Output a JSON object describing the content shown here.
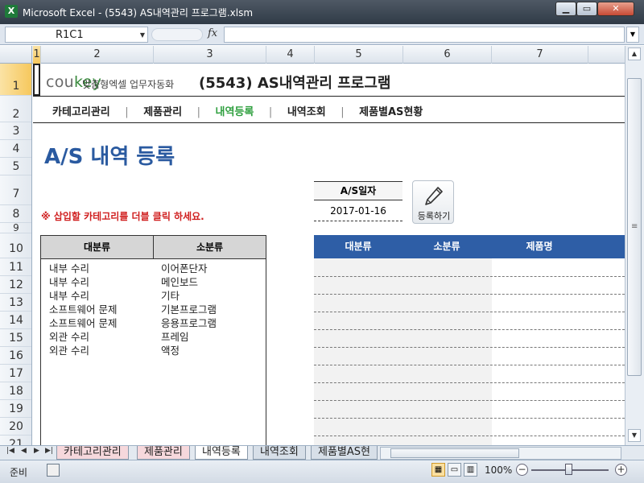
{
  "window": {
    "title": "Microsoft Excel - (5543) AS내역관리 프로그램.xlsm",
    "minimize": "▁",
    "maximize": "▭",
    "close": "✕"
  },
  "formula_bar": {
    "name_box": "R1C1",
    "fx": "fx",
    "formula": ""
  },
  "columns": [
    "1",
    "2",
    "3",
    "4",
    "5",
    "6",
    "7"
  ],
  "rows": [
    "1",
    "2",
    "3",
    "4",
    "5",
    "7",
    "8",
    "9",
    "10",
    "11",
    "12",
    "13",
    "14",
    "15",
    "16",
    "17",
    "18",
    "19",
    "20",
    "21"
  ],
  "header": {
    "logo_a": "cou",
    "logo_b": "key",
    "logo_sub": "맞춤형엑셀 업무자동화",
    "program_title": "(5543) AS내역관리 프로그램"
  },
  "nav": {
    "items": [
      "카테고리관리",
      "제품관리",
      "내역등록",
      "내역조회",
      "제품별AS현황"
    ],
    "separator": "|",
    "active": "내역등록"
  },
  "page": {
    "heading": "A/S 내역 등록",
    "hint": "※ 삽입할 카테고리를 더블 클릭 하세요."
  },
  "date_field": {
    "label": "A/S일자",
    "value": "2017-01-16"
  },
  "register_button": {
    "label": "등록하기",
    "icon": "pencil-icon"
  },
  "category_table": {
    "headers": [
      "대분류",
      "소분류"
    ],
    "rows": [
      [
        "내부 수리",
        "이어폰단자"
      ],
      [
        "내부 수리",
        "메인보드"
      ],
      [
        "내부 수리",
        "기타"
      ],
      [
        "소프트웨어 문제",
        "기본프로그램"
      ],
      [
        "소프트웨어 문제",
        "응용프로그램"
      ],
      [
        "외관 수리",
        "프레임"
      ],
      [
        "외관 수리",
        "액정"
      ]
    ]
  },
  "entry_table": {
    "headers": [
      "대분류",
      "소분류",
      "제품명"
    ],
    "header_color": "#2e5ea6"
  },
  "sheet_tabs": {
    "tabs": [
      "카테고리관리",
      "제품관리",
      "내역등록",
      "내역조회",
      "제품별AS현"
    ],
    "active": "내역등록"
  },
  "status_bar": {
    "ready": "준비",
    "zoom": "100%",
    "zoom_out": "−",
    "zoom_in": "+"
  }
}
